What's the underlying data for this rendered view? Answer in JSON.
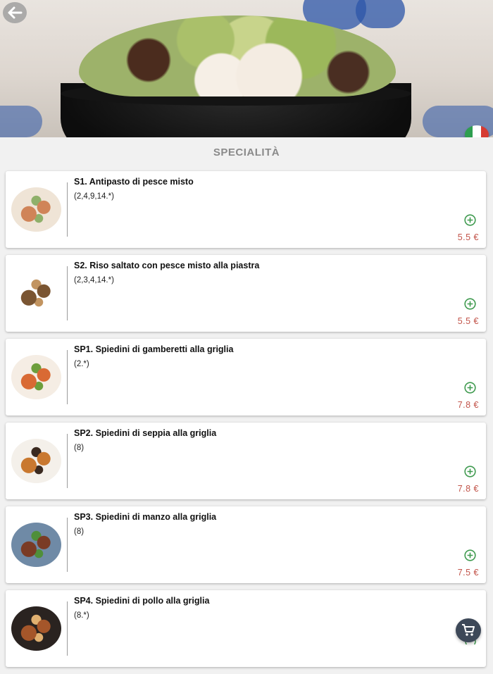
{
  "header": {
    "back_icon": "arrow-left-icon",
    "language_flag": "italy-flag-icon",
    "flag_colors": [
      "#2e9e4f",
      "#ffffff",
      "#d63b32"
    ]
  },
  "section": {
    "title": "SPECIALITÀ"
  },
  "items": [
    {
      "name": "S1. Antipasto di pesce misto",
      "allergens": "(2,4,9,14.*)",
      "price": "5.5 €",
      "thumb_colors": [
        "#efe4d6",
        "#d08458",
        "#8fb06a"
      ]
    },
    {
      "name": "S2. Riso saltato con pesce misto alla piastra",
      "allergens": "(2,3,4,14.*)",
      "price": "5.5 €",
      "thumb_colors": [
        "#ffffff",
        "#7a5532",
        "#c29460"
      ]
    },
    {
      "name": "SP1. Spiedini di gamberetti alla griglia",
      "allergens": "(2.*)",
      "price": "7.8 €",
      "thumb_colors": [
        "#f5ede4",
        "#d96a34",
        "#6d9e3c"
      ]
    },
    {
      "name": "SP2. Spiedini di seppia alla griglia",
      "allergens": "(8)",
      "price": "7.8 €",
      "thumb_colors": [
        "#f4f0ea",
        "#c9782f",
        "#3b2a20"
      ]
    },
    {
      "name": "SP3. Spiedini di manzo alla griglia",
      "allergens": "(8)",
      "price": "7.5 €",
      "thumb_colors": [
        "#6f8aa6",
        "#7a3b25",
        "#4f8f3a"
      ]
    },
    {
      "name": "SP4. Spiedini di pollo alla griglia",
      "allergens": "(8.*)",
      "price": "",
      "thumb_colors": [
        "#2a2320",
        "#a5562a",
        "#e1b070"
      ]
    }
  ],
  "colors": {
    "accent_green": "#3f9a4f",
    "price_red": "#c2544a",
    "cart_bg": "#3d4858"
  },
  "cart": {
    "icon": "cart-icon"
  }
}
